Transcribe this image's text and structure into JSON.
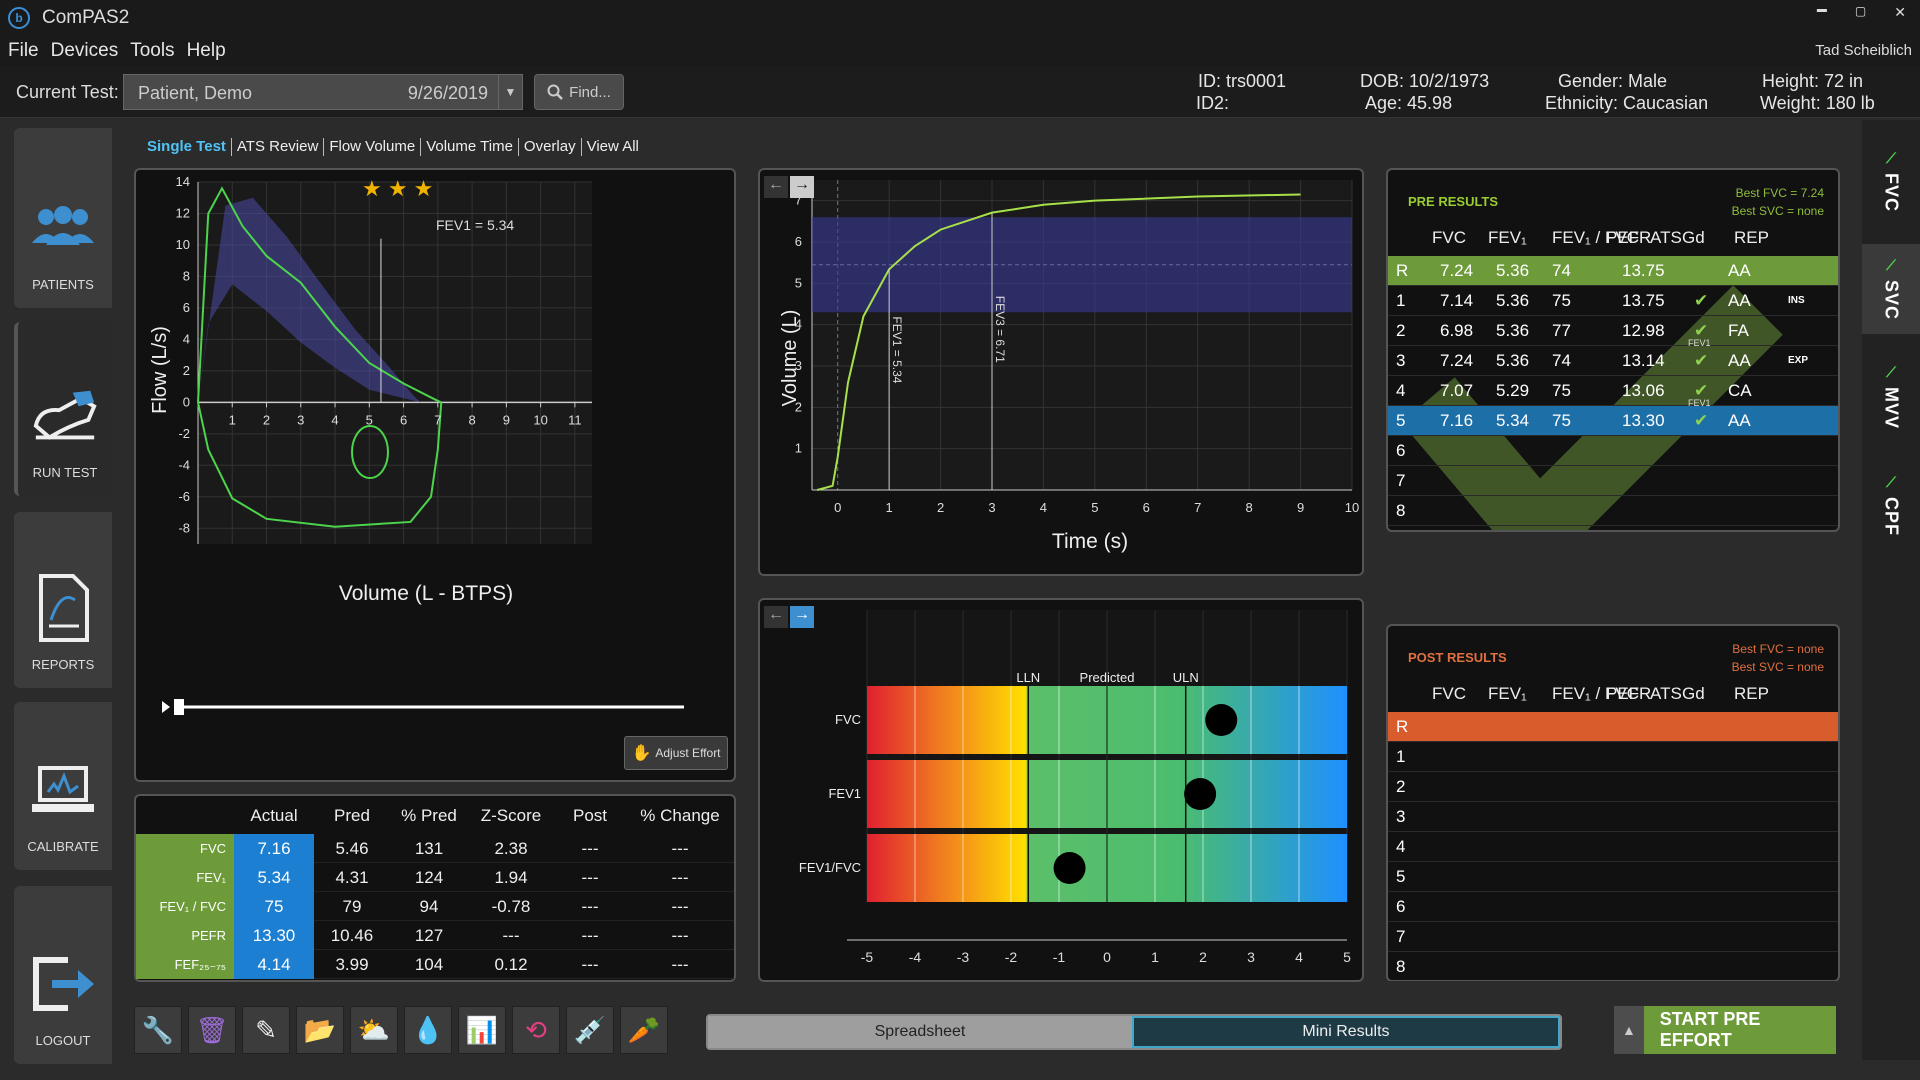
{
  "window": {
    "title": "ComPAS2",
    "min": "▬",
    "max": "▢",
    "close": "✕"
  },
  "menu": [
    "File",
    "Devices",
    "Tools",
    "Help"
  ],
  "user": "Tad Scheiblich",
  "header": {
    "current_test_label": "Current Test:",
    "patient_name": "Patient, Demo",
    "test_date": "9/26/2019",
    "find_label": "Find...",
    "id": "ID:  trs0001",
    "id2": "ID2:",
    "dob": "DOB:  10/2/1973",
    "age": "Age:  45.98",
    "gender": "Gender:  Male",
    "ethnicity": "Ethnicity:  Caucasian",
    "height": "Height:  72 in",
    "weight": "Weight:  180 lb"
  },
  "leftnav": [
    {
      "label": "PATIENTS",
      "icon": "patients-icon"
    },
    {
      "label": "RUN TEST",
      "icon": "run-test-icon"
    },
    {
      "label": "REPORTS",
      "icon": "reports-icon"
    },
    {
      "label": "CALIBRATE",
      "icon": "calibrate-icon"
    },
    {
      "label": "LOGOUT",
      "icon": "logout-icon"
    }
  ],
  "tabs": [
    "Single Test",
    "ATS Review",
    "Flow Volume",
    "Volume Time",
    "Overlay",
    "View All"
  ],
  "flow_volume": {
    "xlabel": "Volume (L - BTPS)",
    "ylabel": "Flow (L/s)",
    "fev1_label": "FEV1 = 5.34",
    "stars": "★ ★ ★",
    "adjust_label": "Adjust Effort",
    "x_ticks": [
      "1",
      "2",
      "3",
      "4",
      "5",
      "6",
      "7",
      "8",
      "9",
      "10",
      "11"
    ],
    "y_ticks": [
      "14",
      "12",
      "10",
      "8",
      "6",
      "4",
      "2",
      "0",
      "-2",
      "-4",
      "-6",
      "-8"
    ]
  },
  "volume_time": {
    "xlabel": "Time (s)",
    "ylabel": "Volume (L)",
    "fev1_label": "FEV1 = 5.34",
    "fev3_label": "FEV3 = 6.71",
    "x_ticks": [
      "0",
      "1",
      "2",
      "3",
      "4",
      "5",
      "6",
      "7",
      "8",
      "9",
      "10"
    ],
    "y_ticks": [
      "7",
      "6",
      "5",
      "4",
      "3",
      "2",
      "1"
    ]
  },
  "zscore": {
    "labels": [
      "LLN",
      "Predicted",
      "ULN"
    ],
    "rows": [
      "FVC",
      "FEV1",
      "FEV1/FVC"
    ],
    "x_ticks": [
      "-5",
      "-4",
      "-3",
      "-2",
      "-1",
      "0",
      "1",
      "2",
      "3",
      "4",
      "5"
    ]
  },
  "chart_data": [
    {
      "type": "line",
      "title": "",
      "xlabel": "Volume (L - BTPS)",
      "ylabel": "Flow (L/s)",
      "xlim": [
        0,
        11.5
      ],
      "ylim": [
        -9,
        14
      ],
      "series": [
        {
          "values": [
            [
              0,
              0
            ],
            [
              0.3,
              12
            ],
            [
              0.7,
              13.6
            ],
            [
              1.3,
              11.2
            ],
            [
              2,
              9.3
            ],
            [
              3,
              7.6
            ],
            [
              4,
              4.8
            ],
            [
              5,
              2.5
            ],
            [
              6,
              1.2
            ],
            [
              6.9,
              0.2
            ],
            [
              7.1,
              0
            ]
          ]
        },
        {
          "values": [
            [
              7.1,
              0
            ],
            [
              7,
              -3
            ],
            [
              6.8,
              -6
            ],
            [
              6.2,
              -7.6
            ],
            [
              4,
              -7.9
            ],
            [
              2,
              -7.4
            ],
            [
              1,
              -6.1
            ],
            [
              0.3,
              -3
            ],
            [
              0,
              0
            ]
          ]
        }
      ],
      "annotation": "FEV1 = 5.34"
    },
    {
      "type": "line",
      "title": "",
      "xlabel": "Time (s)",
      "ylabel": "Volume (L)",
      "xlim": [
        -0.5,
        10
      ],
      "ylim": [
        0,
        7.5
      ],
      "series": [
        {
          "values": [
            [
              -0.4,
              0
            ],
            [
              -0.1,
              0.1
            ],
            [
              0,
              0.8
            ],
            [
              0.2,
              2.6
            ],
            [
              0.5,
              4.2
            ],
            [
              1,
              5.34
            ],
            [
              1.5,
              5.9
            ],
            [
              2,
              6.3
            ],
            [
              3,
              6.71
            ],
            [
              4,
              6.9
            ],
            [
              5,
              7.0
            ],
            [
              7,
              7.1
            ],
            [
              9,
              7.15
            ]
          ]
        }
      ],
      "annotations": [
        "FEV1 = 5.34",
        "FEV3 = 6.71"
      ]
    },
    {
      "type": "scatter",
      "title": "",
      "xlim": [
        -5,
        5
      ],
      "categories": [
        "FVC",
        "FEV1",
        "FEV1/FVC"
      ],
      "values": [
        2.38,
        1.94,
        -0.78
      ],
      "lln": -1.64,
      "uln": 1.64
    }
  ],
  "measure_table": {
    "headers": [
      "",
      "Actual",
      "Pred",
      "% Pred",
      "Z-Score",
      "Post",
      "% Change"
    ],
    "rows": [
      [
        "FVC",
        "7.16",
        "5.46",
        "131",
        "2.38",
        "---",
        "---"
      ],
      [
        "FEV₁",
        "5.34",
        "4.31",
        "124",
        "1.94",
        "---",
        "---"
      ],
      [
        "FEV₁ / FVC",
        "75",
        "79",
        "94",
        "-0.78",
        "---",
        "---"
      ],
      [
        "PEFR",
        "13.30",
        "10.46",
        "127",
        "---",
        "---",
        "---"
      ],
      [
        "FEF₂₅₋₇₅",
        "4.14",
        "3.99",
        "104",
        "0.12",
        "---",
        "---"
      ]
    ]
  },
  "pre_results": {
    "title": "PRE RESULTS",
    "best_fvc": "Best FVC = 7.24",
    "best_svc": "Best SVC = none",
    "headers": [
      "FVC",
      "FEV₁",
      "FEV₁ / FVC",
      "PEFR",
      "ATS",
      "Gd",
      "REP"
    ],
    "rows": [
      [
        "R",
        "7.24",
        "5.36",
        "74",
        "13.75",
        "",
        "AA",
        ""
      ],
      [
        "1",
        "7.14",
        "5.36",
        "75",
        "13.75",
        "✔",
        "AA",
        "INS"
      ],
      [
        "2",
        "6.98",
        "5.36",
        "77",
        "12.98",
        "✔",
        "FA",
        ""
      ],
      [
        "3",
        "7.24",
        "5.36",
        "74",
        "13.14",
        "✔",
        "AA",
        "EXP"
      ],
      [
        "4",
        "7.07",
        "5.29",
        "75",
        "13.06",
        "✔",
        "CA",
        ""
      ],
      [
        "5",
        "7.16",
        "5.34",
        "75",
        "13.30",
        "✔",
        "AA",
        ""
      ],
      [
        "6",
        "",
        "",
        "",
        "",
        "",
        "",
        ""
      ],
      [
        "7",
        "",
        "",
        "",
        "",
        "",
        "",
        ""
      ],
      [
        "8",
        "",
        "",
        "",
        "",
        "",
        "",
        ""
      ]
    ],
    "fev1_mark": "FEV1"
  },
  "post_results": {
    "title": "POST RESULTS",
    "best_fvc": "Best FVC = none",
    "best_svc": "Best SVC = none",
    "headers": [
      "FVC",
      "FEV₁",
      "FEV₁ / FVC",
      "PEFR",
      "ATS",
      "Gd",
      "REP"
    ],
    "rows": [
      "R",
      "1",
      "2",
      "3",
      "4",
      "5",
      "6",
      "7",
      "8"
    ]
  },
  "toolbar": [
    "wrench-icon",
    "trash-icon",
    "edit-icon",
    "folder-patient-icon",
    "weather-icon",
    "blood-drop-icon",
    "chart-icon",
    "reset-icon",
    "syringe-icon",
    "carrot-icon"
  ],
  "view_toggle": {
    "left": "Spreadsheet",
    "right": "Mini Results"
  },
  "start_button": "START PRE EFFORT",
  "rightnav": [
    "FVC",
    "SVC",
    "MVV",
    "CPF"
  ],
  "colors": {
    "accent": "#6e9b3a",
    "post": "#d85c2c",
    "selected": "#1d6fa8",
    "tab_active": "#4fc3f7"
  }
}
